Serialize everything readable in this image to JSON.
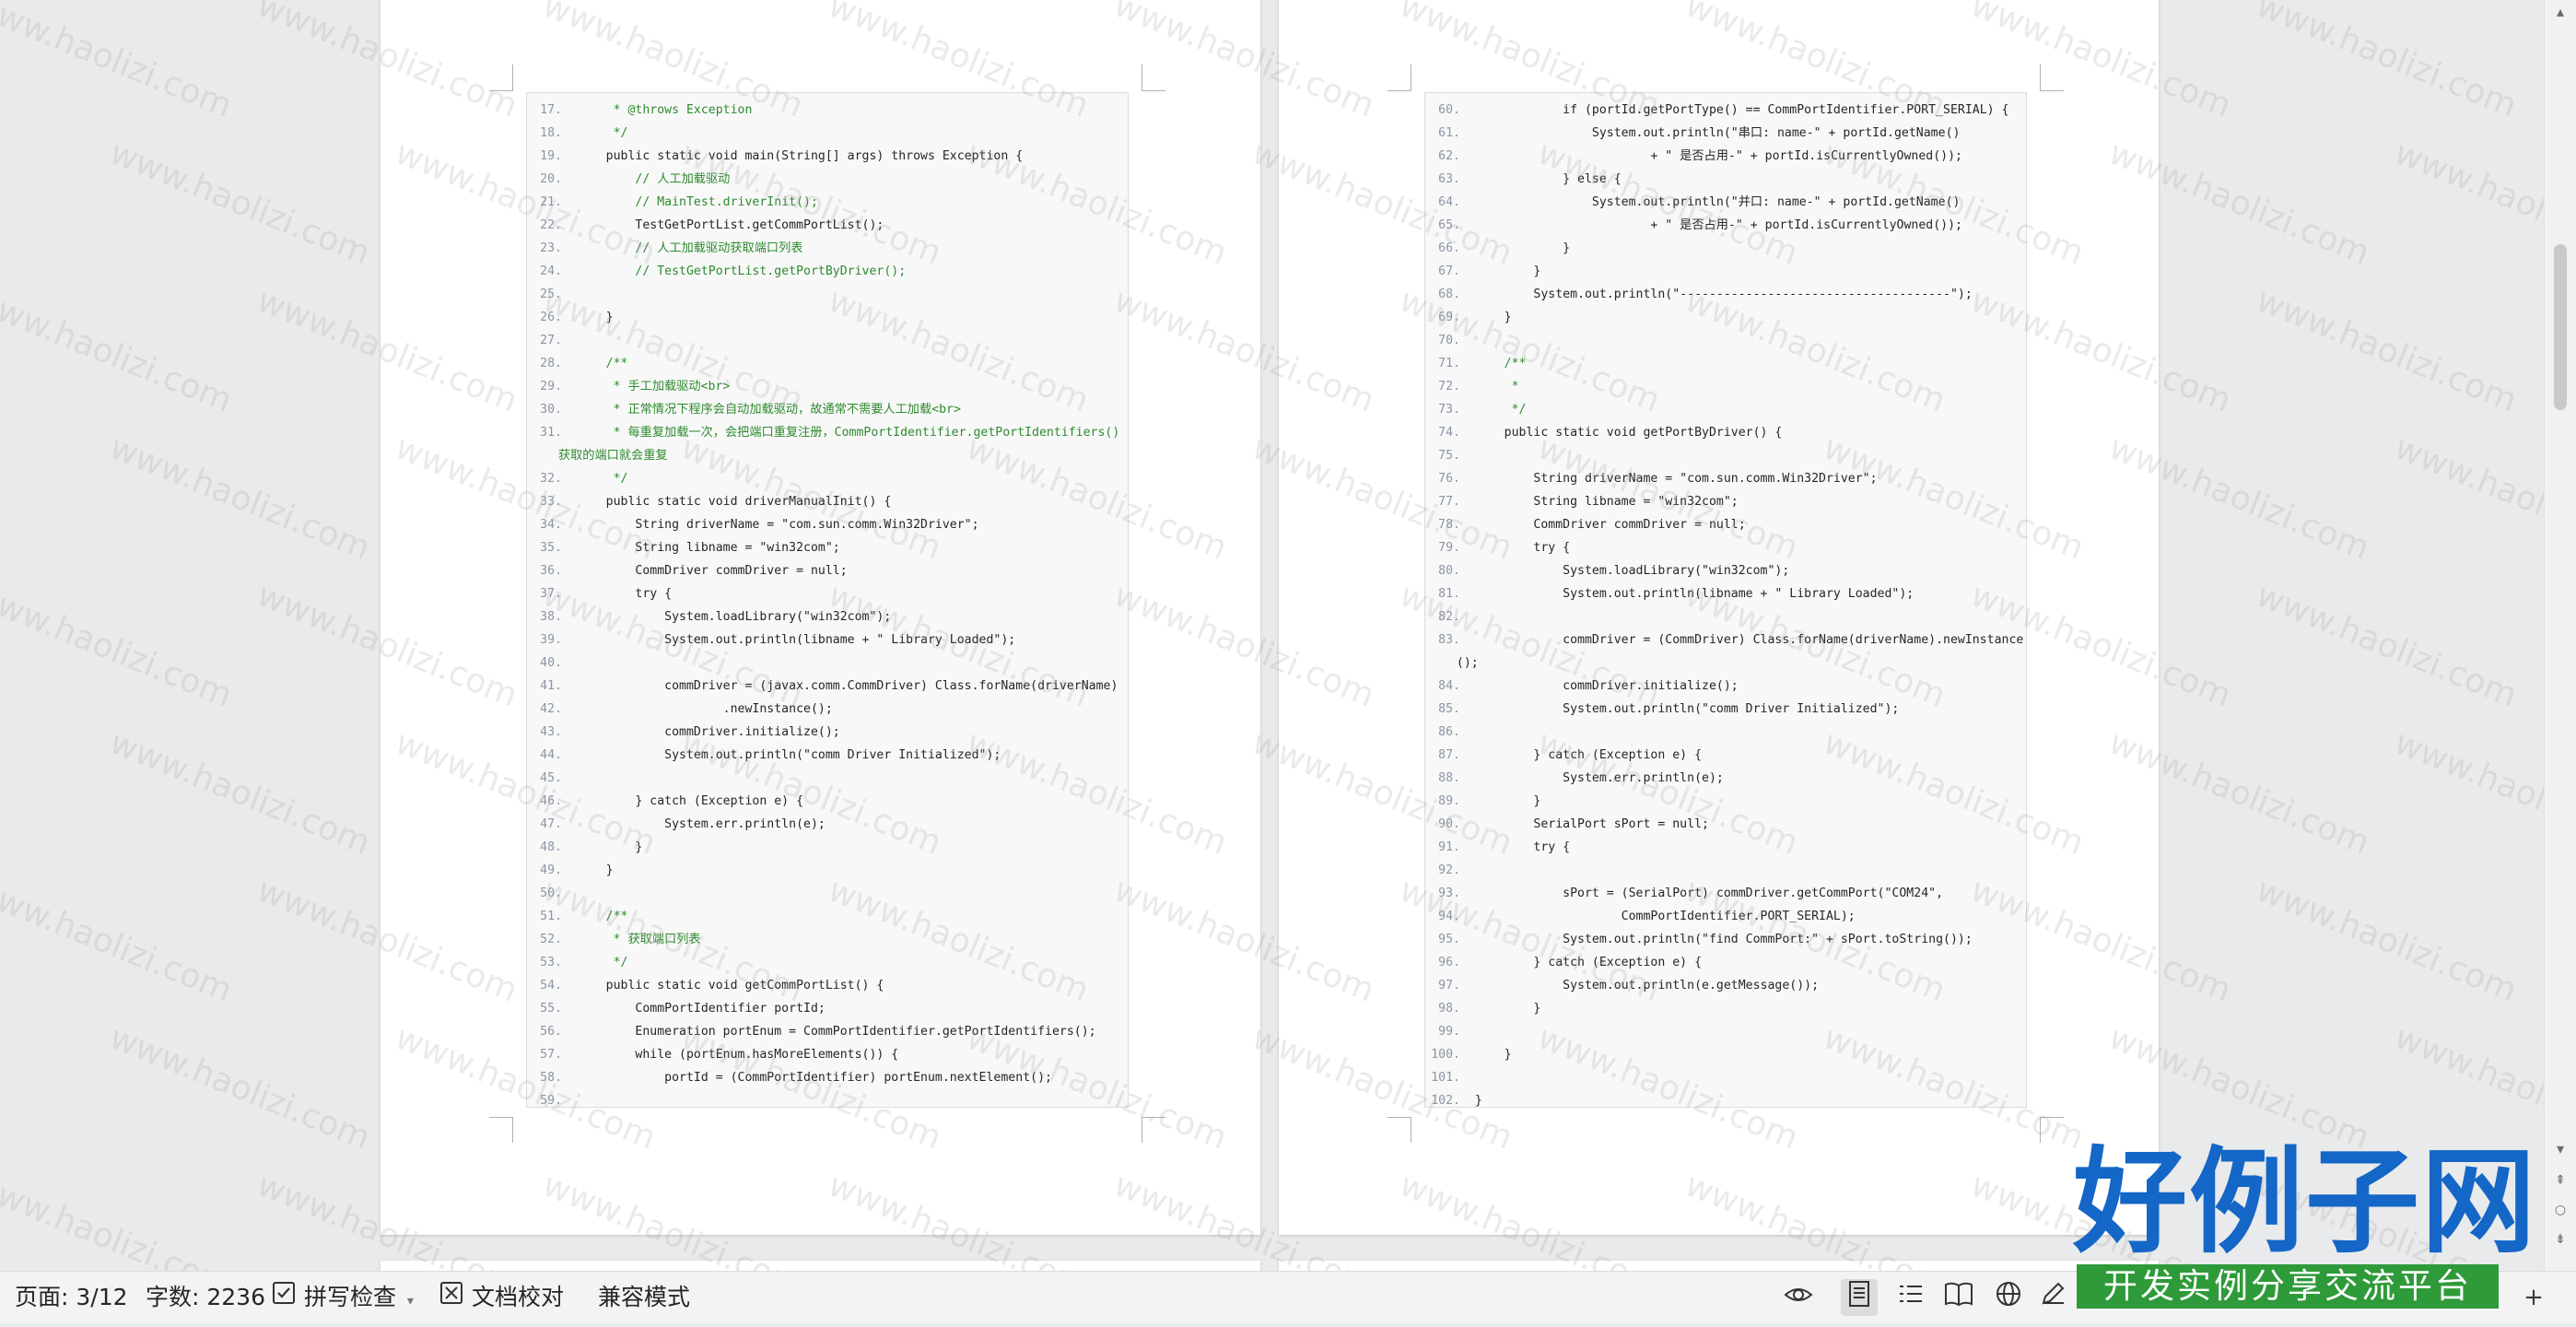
{
  "document": {
    "left_page_lines": [
      {
        "n": "17.",
        "t": "     * @throws Exception",
        "c": "cmt"
      },
      {
        "n": "18.",
        "t": "     */",
        "c": "cmt"
      },
      {
        "n": "19.",
        "t": "    public static void main(String[] args) throws Exception {"
      },
      {
        "n": "20.",
        "t": "        // 人工加载驱动",
        "c": "cmt"
      },
      {
        "n": "21.",
        "t": "        // MainTest.driverInit();",
        "c": "cmt"
      },
      {
        "n": "22.",
        "t": "        TestGetPortList.getCommPortList();"
      },
      {
        "n": "23.",
        "t": "        // 人工加载驱动获取端口列表",
        "c": "cmt"
      },
      {
        "n": "24.",
        "t": "        // TestGetPortList.getPortByDriver();",
        "c": "cmt"
      },
      {
        "n": "25.",
        "t": ""
      },
      {
        "n": "26.",
        "t": "    }"
      },
      {
        "n": "27.",
        "t": ""
      },
      {
        "n": "28.",
        "t": "    /**",
        "c": "cmt"
      },
      {
        "n": "29.",
        "t": "     * 手工加载驱动<br>",
        "c": "cmt"
      },
      {
        "n": "30.",
        "t": "     * 正常情况下程序会自动加载驱动，故通常不需要人工加载<br>",
        "c": "cmt"
      },
      {
        "n": "31.",
        "t": "     * 每重复加载一次，会把端口重复注册，CommPortIdentifier.getPortIdentifiers()",
        "c": "cmt"
      },
      {
        "n": "",
        "t": "获取的端口就会重复",
        "c": "cmt",
        "wrap": true
      },
      {
        "n": "32.",
        "t": "     */",
        "c": "cmt"
      },
      {
        "n": "33.",
        "t": "    public static void driverManualInit() {"
      },
      {
        "n": "34.",
        "t": "        String driverName = \"com.sun.comm.Win32Driver\";"
      },
      {
        "n": "35.",
        "t": "        String libname = \"win32com\";"
      },
      {
        "n": "36.",
        "t": "        CommDriver commDriver = null;"
      },
      {
        "n": "37.",
        "t": "        try {"
      },
      {
        "n": "38.",
        "t": "            System.loadLibrary(\"win32com\");"
      },
      {
        "n": "39.",
        "t": "            System.out.println(libname + \" Library Loaded\");"
      },
      {
        "n": "40.",
        "t": ""
      },
      {
        "n": "41.",
        "t": "            commDriver = (javax.comm.CommDriver) Class.forName(driverName)"
      },
      {
        "n": "42.",
        "t": "                    .newInstance();"
      },
      {
        "n": "43.",
        "t": "            commDriver.initialize();"
      },
      {
        "n": "44.",
        "t": "            System.out.println(\"comm Driver Initialized\");"
      },
      {
        "n": "45.",
        "t": ""
      },
      {
        "n": "46.",
        "t": "        } catch (Exception e) {"
      },
      {
        "n": "47.",
        "t": "            System.err.println(e);"
      },
      {
        "n": "48.",
        "t": "        }"
      },
      {
        "n": "49.",
        "t": "    }"
      },
      {
        "n": "50.",
        "t": ""
      },
      {
        "n": "51.",
        "t": "    /**",
        "c": "cmt"
      },
      {
        "n": "52.",
        "t": "     * 获取端口列表",
        "c": "cmt"
      },
      {
        "n": "53.",
        "t": "     */",
        "c": "cmt"
      },
      {
        "n": "54.",
        "t": "    public static void getCommPortList() {"
      },
      {
        "n": "55.",
        "t": "        CommPortIdentifier portId;"
      },
      {
        "n": "56.",
        "t": "        Enumeration portEnum = CommPortIdentifier.getPortIdentifiers();"
      },
      {
        "n": "57.",
        "t": "        while (portEnum.hasMoreElements()) {"
      },
      {
        "n": "58.",
        "t": "            portId = (CommPortIdentifier) portEnum.nextElement();"
      },
      {
        "n": "59.",
        "t": ""
      }
    ],
    "right_page_lines": [
      {
        "n": "60.",
        "t": "            if (portId.getPortType() == CommPortIdentifier.PORT_SERIAL) {"
      },
      {
        "n": "61.",
        "t": "                System.out.println(\"串口: name-\" + portId.getName()"
      },
      {
        "n": "62.",
        "t": "                        + \" 是否占用-\" + portId.isCurrentlyOwned());"
      },
      {
        "n": "63.",
        "t": "            } else {"
      },
      {
        "n": "64.",
        "t": "                System.out.println(\"并口: name-\" + portId.getName()"
      },
      {
        "n": "65.",
        "t": "                        + \" 是否占用-\" + portId.isCurrentlyOwned());"
      },
      {
        "n": "66.",
        "t": "            }"
      },
      {
        "n": "67.",
        "t": "        }"
      },
      {
        "n": "68.",
        "t": "        System.out.println(\"-------------------------------------\");"
      },
      {
        "n": "69.",
        "t": "    }"
      },
      {
        "n": "70.",
        "t": ""
      },
      {
        "n": "71.",
        "t": "    /**",
        "c": "cmt"
      },
      {
        "n": "72.",
        "t": "     *",
        "c": "cmt"
      },
      {
        "n": "73.",
        "t": "     */",
        "c": "cmt"
      },
      {
        "n": "74.",
        "t": "    public static void getPortByDriver() {"
      },
      {
        "n": "75.",
        "t": ""
      },
      {
        "n": "76.",
        "t": "        String driverName = \"com.sun.comm.Win32Driver\";"
      },
      {
        "n": "77.",
        "t": "        String libname = \"win32com\";"
      },
      {
        "n": "78.",
        "t": "        CommDriver commDriver = null;"
      },
      {
        "n": "79.",
        "t": "        try {"
      },
      {
        "n": "80.",
        "t": "            System.loadLibrary(\"win32com\");"
      },
      {
        "n": "81.",
        "t": "            System.out.println(libname + \" Library Loaded\");"
      },
      {
        "n": "82.",
        "t": ""
      },
      {
        "n": "83.",
        "t": "            commDriver = (CommDriver) Class.forName(driverName).newInstance"
      },
      {
        "n": "",
        "t": "();",
        "wrap": true
      },
      {
        "n": "84.",
        "t": "            commDriver.initialize();"
      },
      {
        "n": "85.",
        "t": "            System.out.println(\"comm Driver Initialized\");"
      },
      {
        "n": "86.",
        "t": ""
      },
      {
        "n": "87.",
        "t": "        } catch (Exception e) {"
      },
      {
        "n": "88.",
        "t": "            System.err.println(e);"
      },
      {
        "n": "89.",
        "t": "        }"
      },
      {
        "n": "90.",
        "t": "        SerialPort sPort = null;"
      },
      {
        "n": "91.",
        "t": "        try {"
      },
      {
        "n": "92.",
        "t": ""
      },
      {
        "n": "93.",
        "t": "            sPort = (SerialPort) commDriver.getCommPort(\"COM24\","
      },
      {
        "n": "94.",
        "t": "                    CommPortIdentifier.PORT_SERIAL);"
      },
      {
        "n": "95.",
        "t": "            System.out.println(\"find CommPort:\" + sPort.toString());"
      },
      {
        "n": "96.",
        "t": "        } catch (Exception e) {"
      },
      {
        "n": "97.",
        "t": "            System.out.println(e.getMessage());"
      },
      {
        "n": "98.",
        "t": "        }"
      },
      {
        "n": "99.",
        "t": ""
      },
      {
        "n": "100.",
        "t": "    }"
      },
      {
        "n": "101.",
        "t": ""
      },
      {
        "n": "102.",
        "t": "}"
      }
    ]
  },
  "watermark": {
    "text": "www.haolizi.com"
  },
  "statusbar": {
    "page": "页面: 3/12",
    "word_count": "字数: 2236",
    "spell_check": "拼写检查",
    "doc_proof": "文档校对",
    "compat_mode": "兼容模式"
  },
  "logo": {
    "main": "好例子网",
    "sub": "开发实例分享交流平台"
  },
  "colors": {
    "comment": "#2e8b2e",
    "line_number": "#8b95a3",
    "logo_blue": "#1466c7",
    "logo_green": "#2e9a39"
  },
  "icons": {
    "spell_check": "checkbox-icon",
    "doc_proof": "proofread-icon",
    "eye": "eye-icon",
    "page_view": "page-view-icon",
    "outline": "outline-icon",
    "read": "book-icon",
    "web": "globe-icon",
    "pen": "pen-icon",
    "zoom_out": "minus-icon",
    "zoom_in": "plus-icon"
  }
}
